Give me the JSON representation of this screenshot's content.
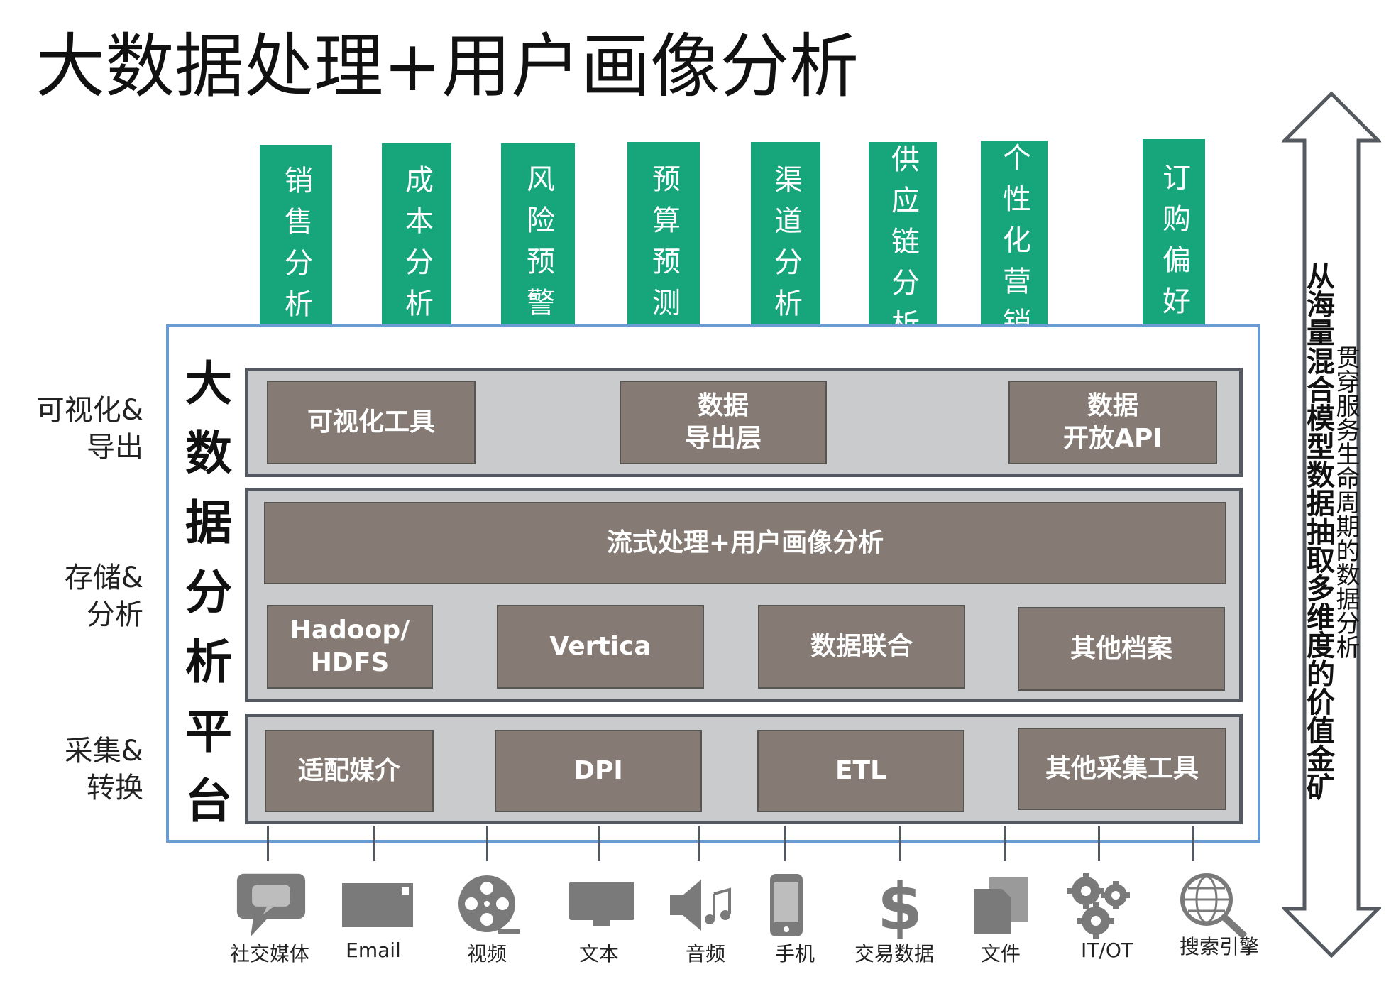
{
  "title": "大数据处理+用户画像分析",
  "applications": [
    "销售分析",
    "成本分析",
    "风险预警",
    "预算预测",
    "渠道分析",
    "供应链分析",
    "个性化营销",
    "订购偏好"
  ],
  "ellipsis": ".....",
  "platform_label": "大数据分析平台",
  "side_labels": {
    "visual": [
      "可视化&",
      "导出"
    ],
    "storage": [
      "存储&",
      "分析"
    ],
    "collect": [
      "采集&",
      "转换"
    ]
  },
  "visual_layer": [
    "可视化工具",
    "数据\n导出层",
    "数据\n开放API"
  ],
  "storage_layer": {
    "streaming": "流式处理+用户画像分析",
    "items": [
      "Hadoop/\nHDFS",
      "Vertica",
      "数据联合",
      "其他档案"
    ]
  },
  "collect_layer": [
    "适配媒介",
    "DPI",
    "ETL",
    "其他采集工具"
  ],
  "sources": [
    {
      "label": "社交媒体",
      "icon": "chat-bubble-icon"
    },
    {
      "label": "Email",
      "icon": "email-icon"
    },
    {
      "label": "视频",
      "icon": "film-reel-icon"
    },
    {
      "label": "文本",
      "icon": "text-monitor-icon"
    },
    {
      "label": "音频",
      "icon": "speaker-music-icon"
    },
    {
      "label": "手机",
      "icon": "mobile-phone-icon"
    },
    {
      "label": "交易数据",
      "icon": "dollar-icon"
    },
    {
      "label": "文件",
      "icon": "files-icon"
    },
    {
      "label": "IT/OT",
      "icon": "gears-icon"
    },
    {
      "label": "搜索引擎",
      "icon": "globe-search-icon"
    }
  ],
  "right_text": {
    "line1": "贯穿服务生命周期的数据分析",
    "line2": "从海量混合模型数据抽取多维度的价值金矿"
  },
  "colors": {
    "green": "#17a67c",
    "box": "#857b74",
    "tier": "#c9cbcc",
    "frame": "#6b9bd3",
    "icon": "#7a7a7a"
  }
}
